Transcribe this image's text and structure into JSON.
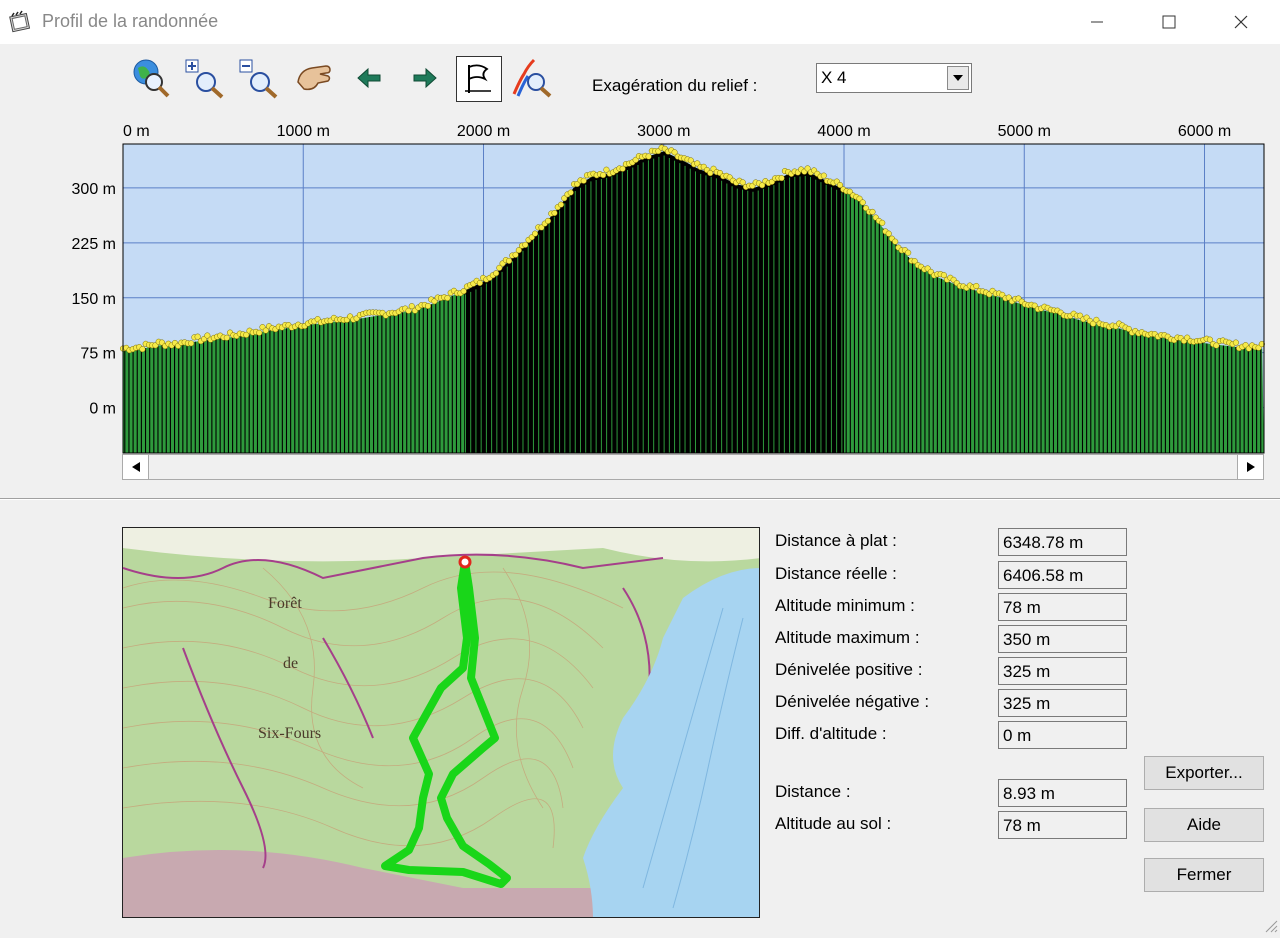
{
  "window": {
    "title": "Profil de la randonnée",
    "controls": [
      "minimize-icon",
      "maximize-icon",
      "close-icon"
    ]
  },
  "toolbar": {
    "tools": [
      "zoom-globe-icon",
      "zoom-in-icon",
      "zoom-out-icon",
      "pan-hand-icon",
      "arrow-left-icon",
      "arrow-right-icon",
      "flag-profile-icon",
      "profile-zoom-icon"
    ],
    "relief_label": "Exagération du relief :",
    "relief_value": "X 4"
  },
  "chart_data": {
    "type": "area",
    "x_ticks": [
      0,
      1000,
      2000,
      3000,
      4000,
      5000,
      6000
    ],
    "x_tick_labels": [
      "0 m",
      "1000 m",
      "2000 m",
      "3000 m",
      "4000 m",
      "5000 m",
      "6000 m"
    ],
    "y_ticks": [
      0,
      75,
      150,
      225,
      300
    ],
    "y_tick_labels": [
      "0 m",
      "75 m",
      "150 m",
      "225 m",
      "300 m"
    ],
    "xlim": [
      0,
      6348.78
    ],
    "ylim": [
      -62,
      360
    ],
    "grid": true,
    "colors": {
      "sky": "#c5dbf5",
      "fill_dark": "#000000",
      "fill_green": "#2e9a3c",
      "points": "#f6ea4a",
      "grid": "#5b7fc6"
    },
    "dark_range": [
      1900,
      4000
    ],
    "profile": {
      "x": [
        0,
        100,
        200,
        300,
        400,
        500,
        600,
        700,
        800,
        900,
        1000,
        1100,
        1200,
        1300,
        1400,
        1500,
        1600,
        1700,
        1800,
        1900,
        2000,
        2100,
        2200,
        2300,
        2400,
        2500,
        2600,
        2700,
        2800,
        2900,
        3000,
        3100,
        3200,
        3300,
        3400,
        3500,
        3600,
        3700,
        3800,
        3900,
        4000,
        4100,
        4200,
        4300,
        4400,
        4500,
        4600,
        4700,
        4800,
        4900,
        5000,
        5100,
        5200,
        5300,
        5400,
        5500,
        5600,
        5700,
        5800,
        5900,
        6000,
        6100,
        6200,
        6348.78
      ],
      "y": [
        78,
        80,
        85,
        84,
        90,
        93,
        96,
        100,
        105,
        108,
        112,
        115,
        118,
        121,
        125,
        128,
        132,
        140,
        150,
        160,
        172,
        190,
        215,
        240,
        268,
        300,
        315,
        320,
        330,
        342,
        350,
        338,
        325,
        318,
        305,
        300,
        308,
        320,
        322,
        310,
        298,
        280,
        250,
        220,
        195,
        180,
        170,
        162,
        155,
        148,
        140,
        133,
        128,
        120,
        114,
        110,
        103,
        98,
        94,
        92,
        88,
        85,
        82,
        80
      ]
    }
  },
  "stats": [
    {
      "label": "Distance à plat :",
      "value": "6348.78 m"
    },
    {
      "label": "Distance réelle :",
      "value": "6406.58 m"
    },
    {
      "label": "Altitude minimum :",
      "value": "78 m"
    },
    {
      "label": "Altitude maximum :",
      "value": "350 m"
    },
    {
      "label": "Dénivelée positive :",
      "value": "325 m"
    },
    {
      "label": "Dénivelée négative :",
      "value": "325 m"
    },
    {
      "label": "Diff. d'altitude :",
      "value": "0 m"
    }
  ],
  "cursor": [
    {
      "label": "Distance :",
      "value": "8.93 m"
    },
    {
      "label": "Altitude au sol :",
      "value": "78 m"
    }
  ],
  "buttons": {
    "export": "Exporter...",
    "help": "Aide",
    "close": "Fermer"
  },
  "map": {
    "labels": [
      "Forêt",
      "de",
      "Six-Fours"
    ],
    "route_color": "#19d619"
  }
}
